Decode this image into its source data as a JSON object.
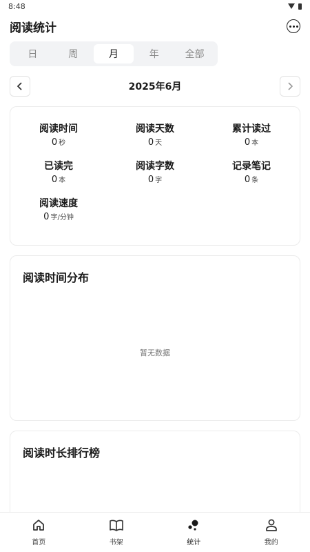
{
  "status_bar": {
    "time": "8:48"
  },
  "header": {
    "title": "阅读统计"
  },
  "period_tabs": [
    {
      "label": "日",
      "active": false
    },
    {
      "label": "周",
      "active": false
    },
    {
      "label": "月",
      "active": true
    },
    {
      "label": "年",
      "active": false
    },
    {
      "label": "全部",
      "active": false
    }
  ],
  "month_nav": {
    "label": "2025年6月",
    "prev_icon": "chevron-left-icon",
    "next_icon": "chevron-right-icon"
  },
  "stats": [
    {
      "label": "阅读时间",
      "value": "0",
      "unit": "秒"
    },
    {
      "label": "阅读天数",
      "value": "0",
      "unit": "天"
    },
    {
      "label": "累计读过",
      "value": "0",
      "unit": "本"
    },
    {
      "label": "已读完",
      "value": "0",
      "unit": "本"
    },
    {
      "label": "阅读字数",
      "value": "0",
      "unit": "字"
    },
    {
      "label": "记录笔记",
      "value": "0",
      "unit": "条"
    },
    {
      "label": "阅读速度",
      "value": "0",
      "unit": "字/分钟"
    }
  ],
  "distribution": {
    "title": "阅读时间分布",
    "empty": "暂无数据"
  },
  "ranking": {
    "title": "阅读时长排行榜"
  },
  "bottom_nav": [
    {
      "label": "首页",
      "icon": "home-icon",
      "active": false
    },
    {
      "label": "书架",
      "icon": "book-icon",
      "active": false
    },
    {
      "label": "统计",
      "icon": "stats-icon",
      "active": true
    },
    {
      "label": "我的",
      "icon": "user-icon",
      "active": false
    }
  ]
}
